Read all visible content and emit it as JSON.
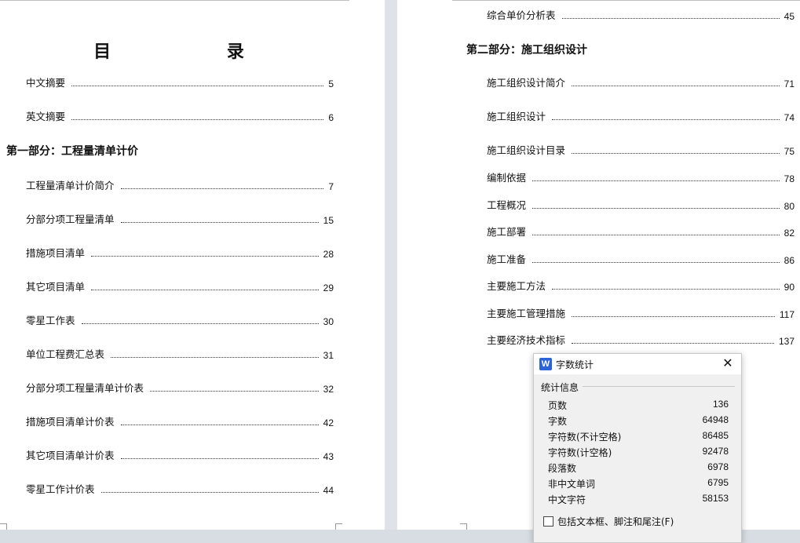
{
  "left_page": {
    "title": "目 录",
    "entries_top": [
      {
        "label": "中文摘要",
        "page": "5"
      },
      {
        "label": "英文摘要",
        "page": "6"
      }
    ],
    "section1": "第一部分：工程量清单计价",
    "entries_s1": [
      {
        "label": "工程量清单计价简介",
        "page": "7"
      },
      {
        "label": "分部分项工程量清单",
        "page": "15"
      },
      {
        "label": "措施项目清单",
        "page": "28"
      },
      {
        "label": "其它项目清单",
        "page": "29"
      },
      {
        "label": "零星工作表",
        "page": "30"
      },
      {
        "label": "单位工程费汇总表",
        "page": "31"
      },
      {
        "label": "分部分项工程量清单计价表",
        "page": "32"
      },
      {
        "label": "措施项目清单计价表",
        "page": "42"
      },
      {
        "label": "其它项目清单计价表",
        "page": "43"
      },
      {
        "label": "零星工作计价表",
        "page": "44"
      }
    ]
  },
  "right_page": {
    "first_entry": {
      "label": "综合单价分析表",
      "page": "45"
    },
    "section2": "第二部分：施工组织设计",
    "entries_s2": [
      {
        "label": "施工组织设计简介",
        "page": "71"
      },
      {
        "label": "施工组织设计",
        "page": "74"
      },
      {
        "label": "施工组织设计目录",
        "page": "75"
      },
      {
        "label": "编制依据",
        "page": "78"
      },
      {
        "label": "工程概况",
        "page": "80"
      },
      {
        "label": "施工部署",
        "page": "82"
      },
      {
        "label": "施工准备",
        "page": "86"
      },
      {
        "label": "主要施工方法",
        "page": "90"
      },
      {
        "label": "主要施工管理措施",
        "page": "117"
      },
      {
        "label": "主要经济技术指标",
        "page": "137"
      }
    ]
  },
  "dialog": {
    "app_icon": "W",
    "title": "字数统计",
    "close_icon": "✕",
    "group_label": "统计信息",
    "stats": [
      {
        "label": "页数",
        "value": "136"
      },
      {
        "label": "字数",
        "value": "64948"
      },
      {
        "label": "字符数(不计空格)",
        "value": "86485"
      },
      {
        "label": "字符数(计空格)",
        "value": "92478"
      },
      {
        "label": "段落数",
        "value": "6978"
      },
      {
        "label": "非中文单词",
        "value": "6795"
      },
      {
        "label": "中文字符",
        "value": "58153"
      }
    ],
    "checkbox_label": "包括文本框、脚注和尾注(F)",
    "checkbox_checked": false,
    "accent_color": "#2b63d9"
  }
}
